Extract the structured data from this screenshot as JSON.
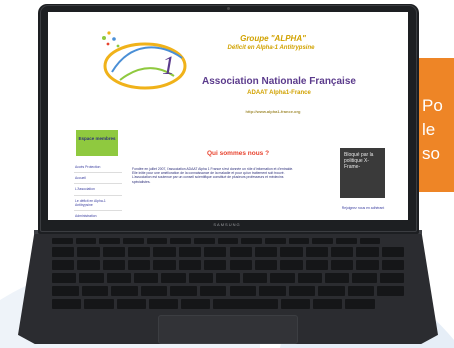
{
  "promo": {
    "line1": "Po",
    "line2": "le",
    "line3": "so",
    "accent_color": "#ee8526"
  },
  "laptop": {
    "brand": "SAMSUNG"
  },
  "website": {
    "group_title": "Groupe \"ALPHA\"",
    "deficit": "Déficit en Alpha-1 Antitrypsine",
    "association": "Association Nationale Française",
    "adaat": "ADAAT Alpha1-France",
    "url": "http://www.alpha1-france.org",
    "menu_header": "Espace membres",
    "menu_items": [
      "Accès Protection",
      "Accueil",
      "L'Association",
      "Le déficit en Alpha-1 Antitrypsine",
      "Administration"
    ],
    "main_title": "Qui sommes nous ?",
    "main_text": "Fondée en juillet 2007, l'association ADAAT Alpha 1 France s'est donnée un rôle d'information et d'entraide. Elle initie pour une amélioration de la connaissance de la maladie et pour qu'un traitement soit trouvé. L'association est soutenue par un conseil scientifique constitué de plusieurs professeurs et médecins spécialistes.",
    "blocked_text": "Bloqué par la politique X-Frame-",
    "join_text": "Rejoignez nous en adhérant",
    "colors": {
      "title_gold": "#d1a200",
      "assoc_purple": "#5b3b8c",
      "menu_green": "#8fc93f",
      "heading_red": "#e8432e"
    }
  }
}
